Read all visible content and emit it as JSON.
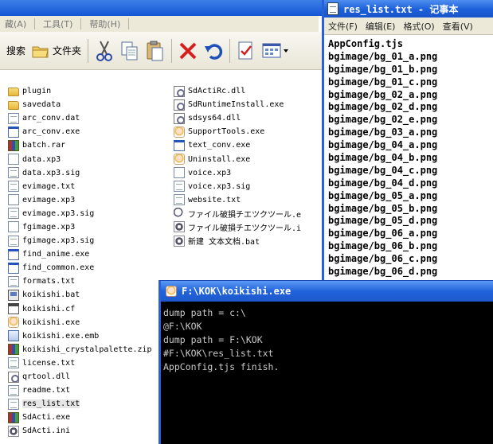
{
  "explorer": {
    "menu": [
      "藏(A)",
      "工具(T)",
      "帮助(H)"
    ],
    "toolbar": {
      "search_label": "搜索",
      "folders_label": "文件夹"
    },
    "files_col1": [
      {
        "name": "plugin",
        "icon": "folder-icon"
      },
      {
        "name": "savedata",
        "icon": "folder-icon"
      },
      {
        "name": "arc_conv.dat",
        "icon": "doc-icon"
      },
      {
        "name": "arc_conv.exe",
        "icon": "exe-icon"
      },
      {
        "name": "batch.rar",
        "icon": "rar-icon"
      },
      {
        "name": "data.xp3",
        "icon": "xp3-icon"
      },
      {
        "name": "data.xp3.sig",
        "icon": "doc-icon"
      },
      {
        "name": "evimage.txt",
        "icon": "doc-icon"
      },
      {
        "name": "evimage.xp3",
        "icon": "xp3-icon"
      },
      {
        "name": "evimage.xp3.sig",
        "icon": "doc-icon"
      },
      {
        "name": "fgimage.xp3",
        "icon": "xp3-icon"
      },
      {
        "name": "fgimage.xp3.sig",
        "icon": "doc-icon"
      },
      {
        "name": "find_anime.exe",
        "icon": "exe-icon"
      },
      {
        "name": "find_common.exe",
        "icon": "exe-icon"
      },
      {
        "name": "formats.txt",
        "icon": "doc-icon"
      },
      {
        "name": "koikishi.bat",
        "icon": "bat-icon"
      },
      {
        "name": "koikishi.cf",
        "icon": "cf-icon"
      },
      {
        "name": "koikishi.exe",
        "icon": "anime-icon"
      },
      {
        "name": "koikishi.exe.emb",
        "icon": "emb-icon"
      },
      {
        "name": "koikishi_crystalpalette.zip",
        "icon": "rar-icon"
      },
      {
        "name": "license.txt",
        "icon": "doc-icon"
      },
      {
        "name": "qrtool.dll",
        "icon": "dll-icon"
      },
      {
        "name": "readme.txt",
        "icon": "doc-icon"
      },
      {
        "name": "res_list.txt",
        "icon": "doc-icon"
      },
      {
        "name": "SdActi.exe",
        "icon": "rar-icon"
      },
      {
        "name": "SdActi.ini",
        "icon": "gear-icon"
      }
    ],
    "files_col2": [
      {
        "name": "SdActiRc.dll",
        "icon": "dll-icon"
      },
      {
        "name": "SdRuntimeInstall.exe",
        "icon": "dll-icon"
      },
      {
        "name": "sdsys64.dll",
        "icon": "dll-icon"
      },
      {
        "name": "SupportTools.exe",
        "icon": "anime-icon"
      },
      {
        "name": "text_conv.exe",
        "icon": "exe-icon"
      },
      {
        "name": "Uninstall.exe",
        "icon": "anime-icon"
      },
      {
        "name": "voice.xp3",
        "icon": "xp3-icon"
      },
      {
        "name": "voice.xp3.sig",
        "icon": "doc-icon"
      },
      {
        "name": "website.txt",
        "icon": "doc-icon"
      },
      {
        "name": "ファイル破損チエツクツール.e",
        "icon": "search-icon"
      },
      {
        "name": "ファイル破損チエツクツール.i",
        "icon": "gear-icon"
      },
      {
        "name": "新建 文本文档.bat",
        "icon": "gear-icon"
      }
    ]
  },
  "notepad": {
    "title": "res_list.txt - 记事本",
    "menu": [
      "文件(F)",
      "编辑(E)",
      "格式(O)",
      "查看(V)"
    ],
    "lines": [
      "AppConfig.tjs",
      "bgimage/bg_01_a.png",
      "bgimage/bg_01_b.png",
      "bgimage/bg_01_c.png",
      "bgimage/bg_02_a.png",
      "bgimage/bg_02_d.png",
      "bgimage/bg_02_e.png",
      "bgimage/bg_03_a.png",
      "bgimage/bg_04_a.png",
      "bgimage/bg_04_b.png",
      "bgimage/bg_04_c.png",
      "bgimage/bg_04_d.png",
      "bgimage/bg_05_a.png",
      "bgimage/bg_05_b.png",
      "bgimage/bg_05_d.png",
      "bgimage/bg_06_a.png",
      "bgimage/bg_06_b.png",
      "bgimage/bg_06_c.png",
      "bgimage/bg_06_d.png"
    ]
  },
  "console": {
    "title": "F:\\KOK\\koikishi.exe",
    "lines": [
      "dump path = c:\\",
      "@F:\\KOK",
      "dump path = F:\\KOK",
      "#F:\\KOK\\res_list.txt",
      "AppConfig.tjs finish."
    ]
  }
}
